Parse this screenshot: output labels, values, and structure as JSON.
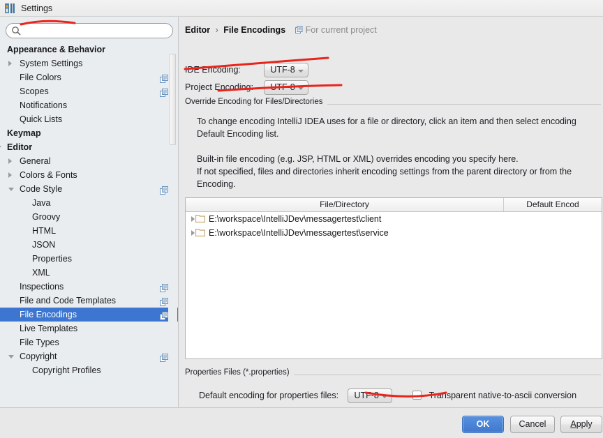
{
  "window": {
    "title": "Settings",
    "icon": "intellij-logo-icon"
  },
  "sidebar": {
    "search": {
      "value": "",
      "placeholder": "",
      "icon": "search-icon"
    },
    "items": [
      {
        "label": "Appearance & Behavior",
        "indent": 10,
        "bold": true,
        "arrow": "none",
        "scope_icon": false
      },
      {
        "label": "System Settings",
        "indent": 28,
        "bold": false,
        "arrow": "collapsed",
        "scope_icon": false
      },
      {
        "label": "File Colors",
        "indent": 28,
        "bold": false,
        "arrow": "none",
        "scope_icon": true
      },
      {
        "label": "Scopes",
        "indent": 28,
        "bold": false,
        "arrow": "none",
        "scope_icon": true
      },
      {
        "label": "Notifications",
        "indent": 28,
        "bold": false,
        "arrow": "none",
        "scope_icon": false
      },
      {
        "label": "Quick Lists",
        "indent": 28,
        "bold": false,
        "arrow": "none",
        "scope_icon": false
      },
      {
        "label": "Keymap",
        "indent": 10,
        "bold": true,
        "arrow": "none",
        "scope_icon": false
      },
      {
        "label": "Editor",
        "indent": 10,
        "bold": true,
        "arrow": "expanded",
        "scope_icon": false
      },
      {
        "label": "General",
        "indent": 28,
        "bold": false,
        "arrow": "collapsed",
        "scope_icon": false
      },
      {
        "label": "Colors & Fonts",
        "indent": 28,
        "bold": false,
        "arrow": "collapsed",
        "scope_icon": false
      },
      {
        "label": "Code Style",
        "indent": 28,
        "bold": false,
        "arrow": "expanded",
        "scope_icon": true
      },
      {
        "label": "Java",
        "indent": 46,
        "bold": false,
        "arrow": "none",
        "scope_icon": false
      },
      {
        "label": "Groovy",
        "indent": 46,
        "bold": false,
        "arrow": "none",
        "scope_icon": false
      },
      {
        "label": "HTML",
        "indent": 46,
        "bold": false,
        "arrow": "none",
        "scope_icon": false
      },
      {
        "label": "JSON",
        "indent": 46,
        "bold": false,
        "arrow": "none",
        "scope_icon": false
      },
      {
        "label": "Properties",
        "indent": 46,
        "bold": false,
        "arrow": "none",
        "scope_icon": false
      },
      {
        "label": "XML",
        "indent": 46,
        "bold": false,
        "arrow": "none",
        "scope_icon": false
      },
      {
        "label": "Inspections",
        "indent": 28,
        "bold": false,
        "arrow": "none",
        "scope_icon": true
      },
      {
        "label": "File and Code Templates",
        "indent": 28,
        "bold": false,
        "arrow": "none",
        "scope_icon": true
      },
      {
        "label": "File Encodings",
        "indent": 28,
        "bold": false,
        "arrow": "none",
        "scope_icon": true,
        "selected": true
      },
      {
        "label": "Live Templates",
        "indent": 28,
        "bold": false,
        "arrow": "none",
        "scope_icon": false
      },
      {
        "label": "File Types",
        "indent": 28,
        "bold": false,
        "arrow": "none",
        "scope_icon": false
      },
      {
        "label": "Copyright",
        "indent": 28,
        "bold": false,
        "arrow": "expanded",
        "scope_icon": true
      },
      {
        "label": "Copyright Profiles",
        "indent": 46,
        "bold": false,
        "arrow": "none",
        "scope_icon": false
      }
    ],
    "selected_label": "File Encodings"
  },
  "main": {
    "breadcrumb": {
      "parent": "Editor",
      "separator": "›",
      "current": "File Encodings",
      "project_badge": "For current project",
      "badge_icon": "project-scope-icon"
    },
    "ide_encoding": {
      "label": "IDE Encoding:",
      "value": "UTF-8"
    },
    "project_encoding": {
      "label": "Project Encoding:",
      "value": "UTF-8"
    },
    "override_group": {
      "title": "Override Encoding for Files/Directories"
    },
    "description": {
      "line1": "To change encoding IntelliJ IDEA uses for a file or directory, click an item and then select encoding",
      "line2": "Default Encoding list.",
      "line3": "Built-in file encoding (e.g. JSP, HTML or XML) overrides encoding you specify here.",
      "line4": "If not specified, files and directories inherit encoding settings from the parent directory or from the",
      "line5": "Encoding."
    },
    "table": {
      "columns": [
        "File/Directory",
        "Default Encod"
      ],
      "rows": [
        {
          "path": "E:\\workspace\\IntelliJDev\\messagertest\\client",
          "encoding": ""
        },
        {
          "path": "E:\\workspace\\IntelliJDev\\messagertest\\service",
          "encoding": ""
        }
      ]
    },
    "properties_group": {
      "title": "Properties Files (*.properties)",
      "default_encoding_label": "Default encoding for properties files:",
      "default_encoding_value": "UTF-8",
      "transparent_checkbox_label": "Transparent native-to-ascii conversion",
      "transparent_checked": false
    }
  },
  "footer": {
    "ok": "OK",
    "cancel": "Cancel",
    "apply_mnemonic": "A",
    "apply_rest": "pply"
  },
  "colors": {
    "selection_blue": "#3c76d1",
    "primary_button": "#4077cd",
    "annotation_red": "#e8251c",
    "folder_icon": "#c9a46a",
    "scope_icon": "#6a93c0",
    "panel_bg": "#e9e9e9",
    "sidebar_bg": "#e9edf0"
  }
}
